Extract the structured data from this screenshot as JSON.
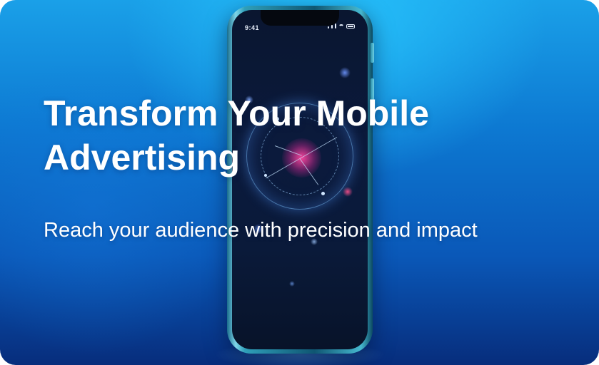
{
  "banner": {
    "headline_line1": "Transform Your Mobile",
    "headline_line2": "Advertising",
    "subheadline": "Reach your audience with precision and impact"
  },
  "phone": {
    "status_time": "9:41",
    "screen_visual": "hologram-target-icon"
  },
  "colors": {
    "background_top": "#1aa0e8",
    "background_bottom": "#072d7c",
    "phone_frame": "#2f9fb9",
    "hologram_core": "#ff46a0",
    "text": "#ffffff"
  }
}
